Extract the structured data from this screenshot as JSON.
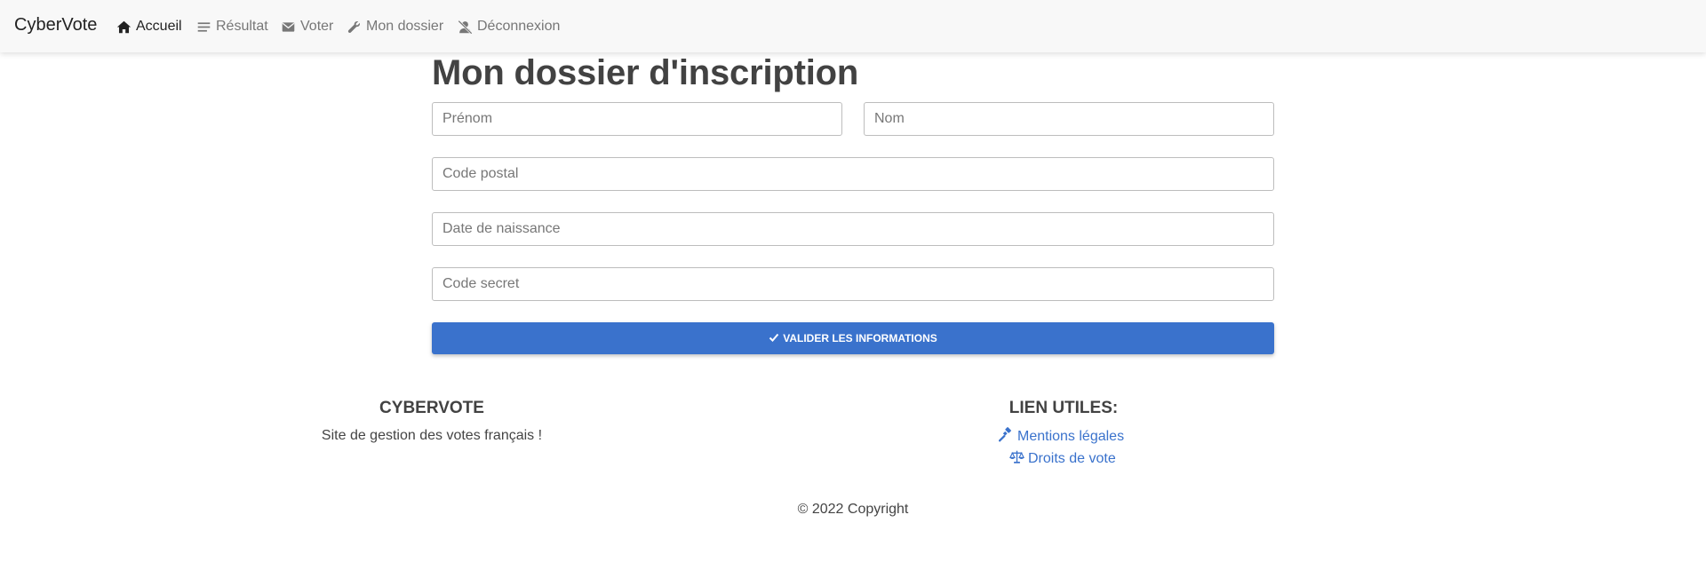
{
  "navbar": {
    "brand": "CyberVote",
    "items": [
      {
        "label": "Accueil",
        "icon": "home-icon",
        "active": true
      },
      {
        "label": "Résultat",
        "icon": "list-icon",
        "active": false
      },
      {
        "label": "Voter",
        "icon": "envelope-icon",
        "active": false
      },
      {
        "label": "Mon dossier",
        "icon": "wrench-icon",
        "active": false
      },
      {
        "label": "Déconnexion",
        "icon": "user-slash-icon",
        "active": false
      }
    ]
  },
  "main": {
    "title": "Mon dossier d'inscription",
    "fields": {
      "firstname": {
        "placeholder": "Prénom",
        "value": ""
      },
      "lastname": {
        "placeholder": "Nom",
        "value": ""
      },
      "postal_code": {
        "placeholder": "Code postal",
        "value": ""
      },
      "birth_date": {
        "placeholder": "Date de naissance",
        "value": ""
      },
      "secret_code": {
        "placeholder": "Code secret",
        "value": ""
      }
    },
    "submit_label": "VALIDER LES INFORMATIONS",
    "submit_icon": "check-icon"
  },
  "footer": {
    "about": {
      "heading": "CYBERVOTE",
      "text": "Site de gestion des votes français !"
    },
    "links": {
      "heading": "LIEN UTILES:",
      "items": [
        {
          "label": "Mentions légales",
          "icon": "gavel-icon"
        },
        {
          "label": "Droits de vote",
          "icon": "balance-scale-icon"
        }
      ]
    },
    "copyright": "© 2022 Copyright"
  },
  "colors": {
    "navbar_bg": "#f8f8f8",
    "primary": "#3a72cc",
    "title": "#424242",
    "nav_inactive": "#777777",
    "nav_active": "#222222"
  }
}
